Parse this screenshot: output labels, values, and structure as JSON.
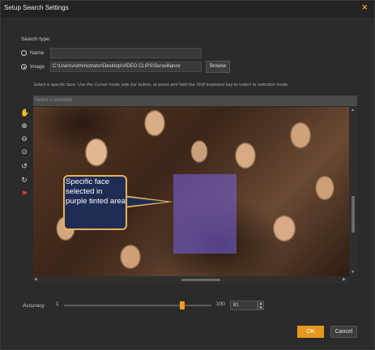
{
  "window": {
    "title": "Setup Search Settings",
    "close_glyph": "✕"
  },
  "search_type": {
    "label": "Search type:",
    "options": [
      {
        "label": "Name",
        "value": "",
        "selected": false
      },
      {
        "label": "Image",
        "value": "C:\\Users\\Administrator\\Desktop\\VIDEO CLIPS\\Surveillance",
        "selected": true
      }
    ],
    "browse_label": "Browse"
  },
  "hint": "Select a specific face. Use the Cursor mode side bar button, or press and hold the Shift keyboard key to switch to selection mode.",
  "image_toolbar": {
    "label": "Select a template"
  },
  "tools": [
    {
      "name": "hand-cursor-icon",
      "glyph": "✋"
    },
    {
      "name": "zoom-in-icon",
      "glyph": "⊕"
    },
    {
      "name": "zoom-out-icon",
      "glyph": "⊖"
    },
    {
      "name": "zoom-fit-icon",
      "glyph": "⊙"
    },
    {
      "name": "rotate-left-icon",
      "glyph": "↺"
    },
    {
      "name": "rotate-right-icon",
      "glyph": "↻"
    },
    {
      "name": "flag-icon",
      "glyph": "⚑"
    }
  ],
  "callout": {
    "text": "Specific face selected in purple tinted area"
  },
  "accuracy": {
    "label": "Accuracy",
    "min": "1",
    "max": "100",
    "value": "81",
    "level": 81
  },
  "buttons": {
    "ok": "OK",
    "cancel": "Cancel"
  },
  "colors": {
    "accent": "#e39a1c",
    "selection": "#7864e6",
    "callout_bg": "#1f2d55",
    "callout_border": "#e7b25a"
  }
}
